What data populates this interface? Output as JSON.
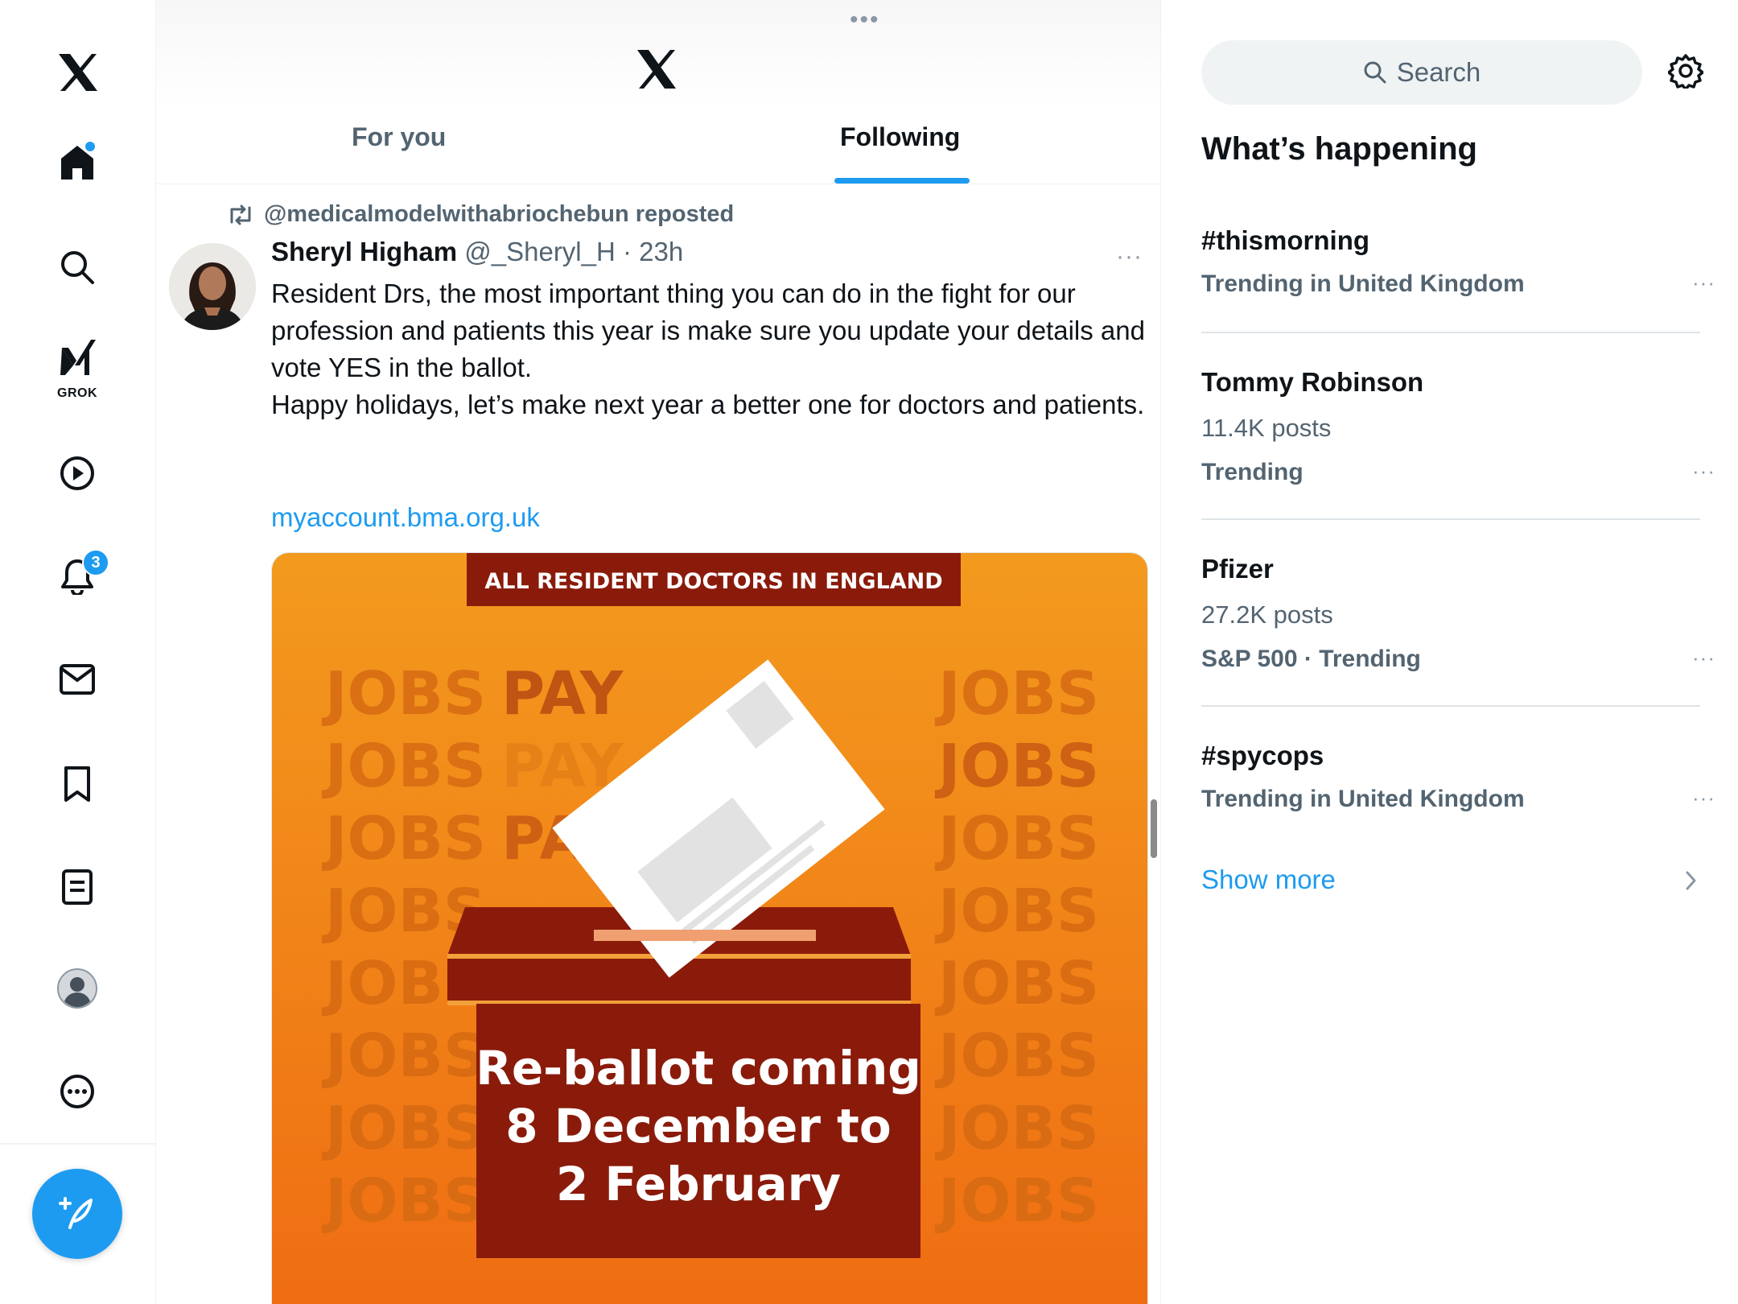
{
  "nav": {
    "items": [
      {
        "name": "x-logo-icon"
      },
      {
        "name": "home-icon",
        "has_dot": true
      },
      {
        "name": "search-icon"
      },
      {
        "name": "grok-icon",
        "label": "GROK"
      },
      {
        "name": "video-icon"
      },
      {
        "name": "notifications-icon",
        "badge": "3"
      },
      {
        "name": "messages-icon"
      },
      {
        "name": "bookmarks-icon"
      },
      {
        "name": "lists-icon"
      },
      {
        "name": "profile-icon"
      },
      {
        "name": "more-icon"
      }
    ],
    "compose_icon": "compose-icon",
    "accent_color": "#1d9bf0"
  },
  "header": {
    "menu_dots": "•••",
    "tabs": [
      {
        "label": "For you",
        "active": false
      },
      {
        "label": "Following",
        "active": true
      }
    ]
  },
  "post": {
    "repost_label": "@medicalmodelwithabriochebun reposted",
    "author_name": "Sheryl Higham",
    "author_meta": "@_Sheryl_H · 23h",
    "more": "···",
    "text_lines": [
      "Resident Drs, the most important thing you can do in the fight for our profession and patients this year is make sure you update your details and vote YES in the ballot.",
      "Happy holidays, let’s make next year a better one for doctors and patients."
    ],
    "link": "myaccount.bma.org.uk",
    "media": {
      "banner": "ALL RESIDENT DOCTORS IN ENGLAND",
      "box_line1": "Re-ballot coming",
      "box_line2": "8 December to",
      "box_line3": "2 February",
      "bg_words": [
        "JOBS",
        "PAY",
        "JOBS",
        "PAY"
      ],
      "colors": {
        "orange_top": "#f39a1e",
        "orange_bottom": "#ef6c12",
        "maroon": "#8a1b0b"
      }
    }
  },
  "sidebar": {
    "search_placeholder": "Search",
    "section_title": "What’s happening",
    "trends": [
      {
        "title": "#thismorning",
        "sub": "",
        "meta": "Trending in United Kingdom"
      },
      {
        "title": "Tommy Robinson",
        "sub": "11.4K posts",
        "meta": "Trending"
      },
      {
        "title": "Pfizer",
        "sub": "27.2K posts",
        "meta": "S&P 500 · Trending"
      },
      {
        "title": "#spycops",
        "sub": "",
        "meta": "Trending in United Kingdom"
      }
    ],
    "show_more": "Show more",
    "more": "···"
  }
}
